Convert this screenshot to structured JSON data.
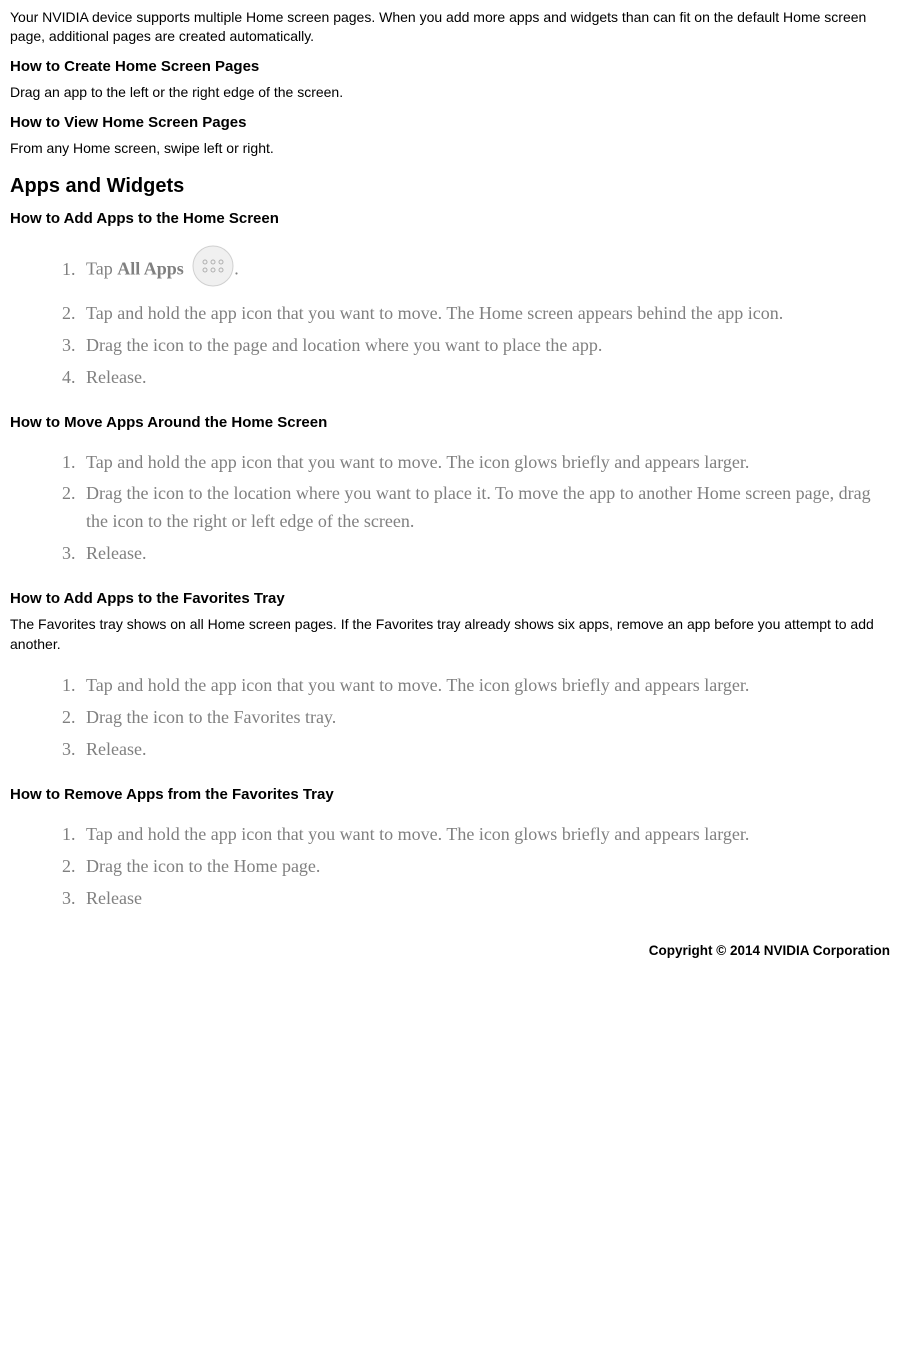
{
  "intro": "Your NVIDIA device supports multiple Home screen pages. When you add more apps and widgets than can fit on the default Home screen page, additional pages are created automatically.",
  "sections": {
    "createPages": {
      "heading": "How to Create Home Screen Pages",
      "body": "Drag an app to the left or the right edge of the screen."
    },
    "viewPages": {
      "heading": "How to View Home Screen Pages",
      "body": "From any Home screen, swipe left or right."
    },
    "appsWidgets": {
      "heading": "Apps and Widgets"
    },
    "addApps": {
      "heading": "How to Add Apps to the Home Screen",
      "step1a": "Tap ",
      "step1b": "All Apps",
      "step1c": " ",
      "step1d": ".",
      "step2": "Tap and hold the app icon that you want to move. The Home screen appears behind the app icon.",
      "step3": "Drag the icon to the page and location where you want to place the app.",
      "step4": "Release."
    },
    "moveApps": {
      "heading": "How to Move Apps Around the Home Screen",
      "step1": "Tap and hold the app icon that you want to move. The icon glows briefly and appears larger.",
      "step2": "Drag the icon to the location where you want to place it. To move the app to another Home screen page, drag the icon to the right or left edge of the screen.",
      "step3": "Release."
    },
    "addFavorites": {
      "heading": "How to Add Apps to the Favorites Tray",
      "body": "The Favorites tray shows on all Home screen pages. If the Favorites tray already shows six apps, remove an app before you attempt to add another.",
      "step1": "Tap and hold the app icon that you want to move. The icon glows briefly and appears larger.",
      "step2": "Drag the icon to the Favorites tray.",
      "step3": "Release."
    },
    "removeFavorites": {
      "heading": "How to Remove Apps from the Favorites Tray",
      "step1": "Tap and hold the app icon that you want to move. The icon glows briefly and appears larger.",
      "step2": "Drag the icon to the Home page.",
      "step3": "Release"
    }
  },
  "footer": "Copyright © 2014 NVIDIA Corporation"
}
